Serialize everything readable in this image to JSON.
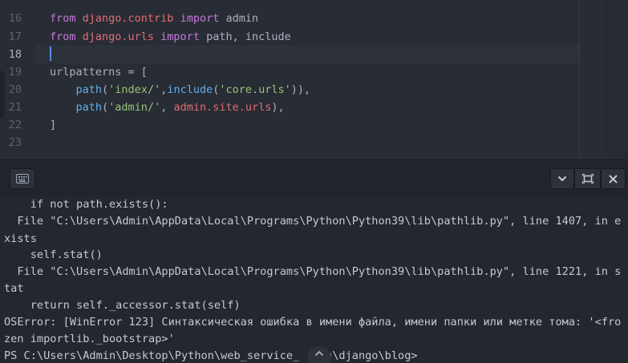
{
  "editor": {
    "line_numbers": [
      "16",
      "17",
      "18",
      "19",
      "20",
      "21",
      "22",
      "23"
    ],
    "active_line": "18",
    "lines": [
      [
        {
          "t": "from ",
          "c": "kw"
        },
        {
          "t": "django.contrib",
          "c": "mod"
        },
        {
          "t": " import ",
          "c": "kw"
        },
        {
          "t": "admin",
          "c": "pl"
        }
      ],
      [
        {
          "t": "from ",
          "c": "kw"
        },
        {
          "t": "django.urls",
          "c": "mod"
        },
        {
          "t": " import ",
          "c": "kw"
        },
        {
          "t": "path, include",
          "c": "pl"
        }
      ],
      [],
      [
        {
          "t": "urlpatterns = [",
          "c": "pl"
        }
      ],
      [
        {
          "t": "    ",
          "c": "pl"
        },
        {
          "t": "path",
          "c": "fn"
        },
        {
          "t": "(",
          "c": "pl"
        },
        {
          "t": "'index/'",
          "c": "str"
        },
        {
          "t": ",",
          "c": "pl"
        },
        {
          "t": "include",
          "c": "fn"
        },
        {
          "t": "(",
          "c": "pl"
        },
        {
          "t": "'core.urls'",
          "c": "str"
        },
        {
          "t": ")),",
          "c": "pl"
        }
      ],
      [
        {
          "t": "    ",
          "c": "pl"
        },
        {
          "t": "path",
          "c": "fn"
        },
        {
          "t": "(",
          "c": "pl"
        },
        {
          "t": "'admin/'",
          "c": "str"
        },
        {
          "t": ", ",
          "c": "pl"
        },
        {
          "t": "admin.site.urls",
          "c": "mod"
        },
        {
          "t": "),",
          "c": "pl"
        }
      ],
      [
        {
          "t": "]",
          "c": "pl"
        }
      ],
      []
    ]
  },
  "toolbar": {
    "icons": {
      "keyboard": "keyboard-icon",
      "chevron": "chevron-down-icon",
      "maximize": "maximize-icon",
      "close": "close-icon"
    }
  },
  "terminal": {
    "lines": [
      "    if not path.exists():",
      "  File \"C:\\Users\\Admin\\AppData\\Local\\Programs\\Python\\Python39\\lib\\pathlib.py\", line 1407, in e",
      "xists",
      "    self.stat()",
      "  File \"C:\\Users\\Admin\\AppData\\Local\\Programs\\Python\\Python39\\lib\\pathlib.py\", line 1221, in s",
      "tat",
      "    return self._accessor.stat(self)",
      "OSError: [WinError 123] Синтаксическая ошибка в имени файла, имени папки или метке тома: '<fro",
      "zen importlib._bootstrap>'",
      "PS C:\\Users\\Admin\\Desktop\\Python\\web_service_    n\\django\\blog>"
    ]
  },
  "colors": {
    "keyword": "#c678dd",
    "module": "#e06c75",
    "string": "#98c379",
    "function": "#61afef",
    "plain": "#abb2bf",
    "cursor": "#528bff"
  }
}
